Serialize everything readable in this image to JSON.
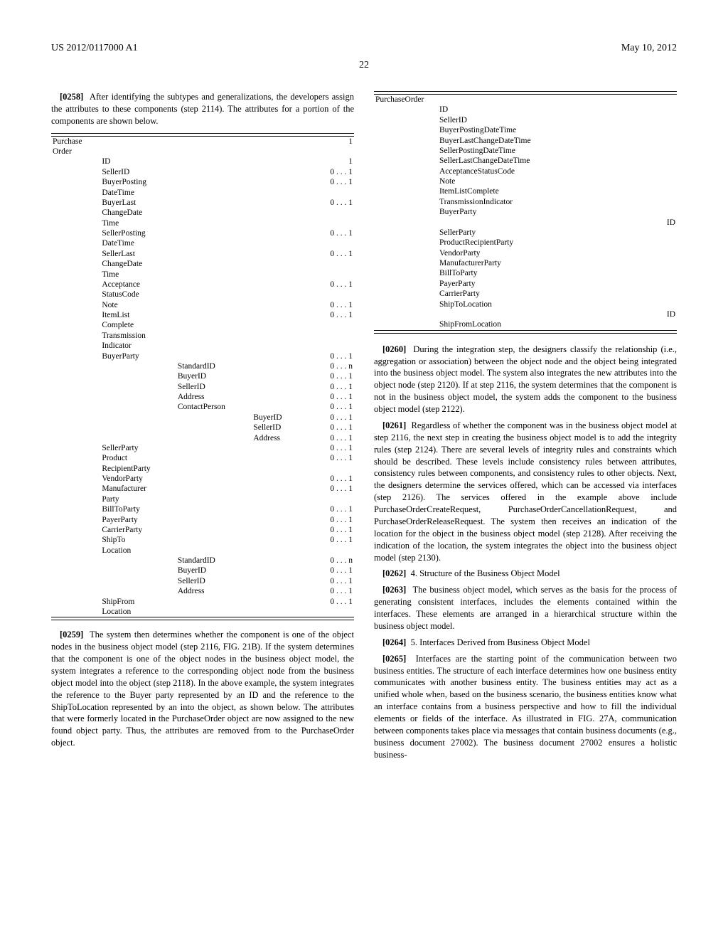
{
  "header": {
    "pub": "US 2012/0117000 A1",
    "date": "May 10, 2012",
    "page": "22"
  },
  "p0258": {
    "num": "[0258]",
    "text": "After identifying the subtypes and generalizations, the developers assign the attributes to these components (step 2114). The attributes for a portion of the components are shown below."
  },
  "table1": {
    "rows": [
      {
        "c0": "Purchase",
        "c1": "",
        "c2": "",
        "c3": "",
        "card": "1"
      },
      {
        "c0": "Order",
        "c1": "",
        "c2": "",
        "c3": "",
        "card": ""
      },
      {
        "c0": "",
        "c1": "ID",
        "c2": "",
        "c3": "",
        "card": "1"
      },
      {
        "c0": "",
        "c1": "SellerID",
        "c2": "",
        "c3": "",
        "card": "0 . . . 1"
      },
      {
        "c0": "",
        "c1": "BuyerPosting",
        "c2": "",
        "c3": "",
        "card": "0 . . . 1"
      },
      {
        "c0": "",
        "c1": "DateTime",
        "c2": "",
        "c3": "",
        "card": ""
      },
      {
        "c0": "",
        "c1": "BuyerLast",
        "c2": "",
        "c3": "",
        "card": "0 . . . 1"
      },
      {
        "c0": "",
        "c1": "ChangeDate",
        "c2": "",
        "c3": "",
        "card": ""
      },
      {
        "c0": "",
        "c1": "Time",
        "c2": "",
        "c3": "",
        "card": ""
      },
      {
        "c0": "",
        "c1": "SellerPosting",
        "c2": "",
        "c3": "",
        "card": "0 . . . 1"
      },
      {
        "c0": "",
        "c1": "DateTime",
        "c2": "",
        "c3": "",
        "card": ""
      },
      {
        "c0": "",
        "c1": "SellerLast",
        "c2": "",
        "c3": "",
        "card": "0 . . . 1"
      },
      {
        "c0": "",
        "c1": "ChangeDate",
        "c2": "",
        "c3": "",
        "card": ""
      },
      {
        "c0": "",
        "c1": "Time",
        "c2": "",
        "c3": "",
        "card": ""
      },
      {
        "c0": "",
        "c1": "Acceptance",
        "c2": "",
        "c3": "",
        "card": "0 . . . 1"
      },
      {
        "c0": "",
        "c1": "StatusCode",
        "c2": "",
        "c3": "",
        "card": ""
      },
      {
        "c0": "",
        "c1": "Note",
        "c2": "",
        "c3": "",
        "card": "0 . . . 1"
      },
      {
        "c0": "",
        "c1": "ItemList",
        "c2": "",
        "c3": "",
        "card": "0 . . . 1"
      },
      {
        "c0": "",
        "c1": "Complete",
        "c2": "",
        "c3": "",
        "card": ""
      },
      {
        "c0": "",
        "c1": "Transmission",
        "c2": "",
        "c3": "",
        "card": ""
      },
      {
        "c0": "",
        "c1": "Indicator",
        "c2": "",
        "c3": "",
        "card": ""
      },
      {
        "c0": "",
        "c1": "BuyerParty",
        "c2": "",
        "c3": "",
        "card": "0 . . . 1"
      },
      {
        "c0": "",
        "c1": "",
        "c2": "StandardID",
        "c3": "",
        "card": "0 . . . n"
      },
      {
        "c0": "",
        "c1": "",
        "c2": "BuyerID",
        "c3": "",
        "card": "0 . . . 1"
      },
      {
        "c0": "",
        "c1": "",
        "c2": "SellerID",
        "c3": "",
        "card": "0 . . . 1"
      },
      {
        "c0": "",
        "c1": "",
        "c2": "Address",
        "c3": "",
        "card": "0 . . . 1"
      },
      {
        "c0": "",
        "c1": "",
        "c2": "ContactPerson",
        "c3": "",
        "card": "0 . . . 1"
      },
      {
        "c0": "",
        "c1": "",
        "c2": "",
        "c3": "BuyerID",
        "card": "0 . . . 1"
      },
      {
        "c0": "",
        "c1": "",
        "c2": "",
        "c3": "SellerID",
        "card": "0 . . . 1"
      },
      {
        "c0": "",
        "c1": "",
        "c2": "",
        "c3": "Address",
        "card": "0 . . . 1"
      },
      {
        "c0": "",
        "c1": "SellerParty",
        "c2": "",
        "c3": "",
        "card": "0 . . . 1"
      },
      {
        "c0": "",
        "c1": "Product",
        "c2": "",
        "c3": "",
        "card": "0 . . . 1"
      },
      {
        "c0": "",
        "c1": "RecipientParty",
        "c2": "",
        "c3": "",
        "card": ""
      },
      {
        "c0": "",
        "c1": "VendorParty",
        "c2": "",
        "c3": "",
        "card": "0 . . . 1"
      },
      {
        "c0": "",
        "c1": "Manufacturer",
        "c2": "",
        "c3": "",
        "card": "0 . . . 1"
      },
      {
        "c0": "",
        "c1": "Party",
        "c2": "",
        "c3": "",
        "card": ""
      },
      {
        "c0": "",
        "c1": "BillToParty",
        "c2": "",
        "c3": "",
        "card": "0 . . . 1"
      },
      {
        "c0": "",
        "c1": "PayerParty",
        "c2": "",
        "c3": "",
        "card": "0 . . . 1"
      },
      {
        "c0": "",
        "c1": "CarrierParty",
        "c2": "",
        "c3": "",
        "card": "0 . . . 1"
      },
      {
        "c0": "",
        "c1": "ShipTo",
        "c2": "",
        "c3": "",
        "card": "0 . . . 1"
      },
      {
        "c0": "",
        "c1": "Location",
        "c2": "",
        "c3": "",
        "card": ""
      },
      {
        "c0": "",
        "c1": "",
        "c2": "StandardID",
        "c3": "",
        "card": "0 . . . n"
      },
      {
        "c0": "",
        "c1": "",
        "c2": "BuyerID",
        "c3": "",
        "card": "0 . . . 1"
      },
      {
        "c0": "",
        "c1": "",
        "c2": "SellerID",
        "c3": "",
        "card": "0 . . . 1"
      },
      {
        "c0": "",
        "c1": "",
        "c2": "Address",
        "c3": "",
        "card": "0 . . . 1"
      },
      {
        "c0": "",
        "c1": "ShipFrom",
        "c2": "",
        "c3": "",
        "card": "0 . . . 1"
      },
      {
        "c0": "",
        "c1": "Location",
        "c2": "",
        "c3": "",
        "card": ""
      }
    ]
  },
  "p0259": {
    "num": "[0259]",
    "text": "The system then determines whether the component is one of the object nodes in the business object model (step 2116, FIG. 21B). If the system determines that the component is one of the object nodes in the business object model, the system integrates a reference to the corresponding object node from the business object model into the object (step 2118). In the above example, the system integrates the reference to the Buyer party represented by an ID and the reference to the ShipToLocation represented by an into the object, as shown below. The attributes that were formerly located in the PurchaseOrder object are now assigned to the new found object party. Thus, the attributes are removed from to the PurchaseOrder object."
  },
  "table2": {
    "rows": [
      {
        "c0": "PurchaseOrder",
        "c1": "",
        "c2": ""
      },
      {
        "c0": "",
        "c1": "ID",
        "c2": ""
      },
      {
        "c0": "",
        "c1": "SellerID",
        "c2": ""
      },
      {
        "c0": "",
        "c1": "BuyerPostingDateTime",
        "c2": ""
      },
      {
        "c0": "",
        "c1": "BuyerLastChangeDateTime",
        "c2": ""
      },
      {
        "c0": "",
        "c1": "SellerPostingDateTime",
        "c2": ""
      },
      {
        "c0": "",
        "c1": "SellerLastChangeDateTime",
        "c2": ""
      },
      {
        "c0": "",
        "c1": "AcceptanceStatusCode",
        "c2": ""
      },
      {
        "c0": "",
        "c1": "Note",
        "c2": ""
      },
      {
        "c0": "",
        "c1": "ItemListComplete",
        "c2": ""
      },
      {
        "c0": "",
        "c1": "TransmissionIndicator",
        "c2": ""
      },
      {
        "c0": "",
        "c1": "BuyerParty",
        "c2": ""
      },
      {
        "c0": "",
        "c1": "",
        "c2": "ID"
      },
      {
        "c0": "",
        "c1": "SellerParty",
        "c2": ""
      },
      {
        "c0": "",
        "c1": "ProductRecipientParty",
        "c2": ""
      },
      {
        "c0": "",
        "c1": "VendorParty",
        "c2": ""
      },
      {
        "c0": "",
        "c1": "ManufacturerParty",
        "c2": ""
      },
      {
        "c0": "",
        "c1": "BillToParty",
        "c2": ""
      },
      {
        "c0": "",
        "c1": "PayerParty",
        "c2": ""
      },
      {
        "c0": "",
        "c1": "CarrierParty",
        "c2": ""
      },
      {
        "c0": "",
        "c1": "ShipToLocation",
        "c2": ""
      },
      {
        "c0": "",
        "c1": "",
        "c2": "ID"
      },
      {
        "c0": "",
        "c1": "ShipFromLocation",
        "c2": ""
      }
    ]
  },
  "p0260": {
    "num": "[0260]",
    "text": "During the integration step, the designers classify the relationship (i.e., aggregation or association) between the object node and the object being integrated into the business object model. The system also integrates the new attributes into the object node (step 2120). If at step 2116, the system determines that the component is not in the business object model, the system adds the component to the business object model (step 2122)."
  },
  "p0261": {
    "num": "[0261]",
    "text": "Regardless of whether the component was in the business object model at step 2116, the next step in creating the business object model is to add the integrity rules (step 2124). There are several levels of integrity rules and constraints which should be described. These levels include consistency rules between attributes, consistency rules between components, and consistency rules to other objects. Next, the designers determine the services offered, which can be accessed via interfaces (step 2126). The services offered in the example above include PurchaseOrderCreateRequest, PurchaseOrderCancellationRequest, and PurchaseOrderReleaseRequest. The system then receives an indication of the location for the object in the business object model (step 2128). After receiving the indication of the location, the system integrates the object into the business object model (step 2130)."
  },
  "p0262": {
    "num": "[0262]",
    "text": "4. Structure of the Business Object Model"
  },
  "p0263": {
    "num": "[0263]",
    "text": "The business object model, which serves as the basis for the process of generating consistent interfaces, includes the elements contained within the interfaces. These elements are arranged in a hierarchical structure within the business object model."
  },
  "p0264": {
    "num": "[0264]",
    "text": "5. Interfaces Derived from Business Object Model"
  },
  "p0265": {
    "num": "[0265]",
    "text": "Interfaces are the starting point of the communication between two business entities. The structure of each interface determines how one business entity communicates with another business entity. The business entities may act as a unified whole when, based on the business scenario, the business entities know what an interface contains from a business perspective and how to fill the individual elements or fields of the interface. As illustrated in FIG. 27A, communication between components takes place via messages that contain business documents (e.g., business document 27002). The business document 27002 ensures a holistic business-"
  }
}
